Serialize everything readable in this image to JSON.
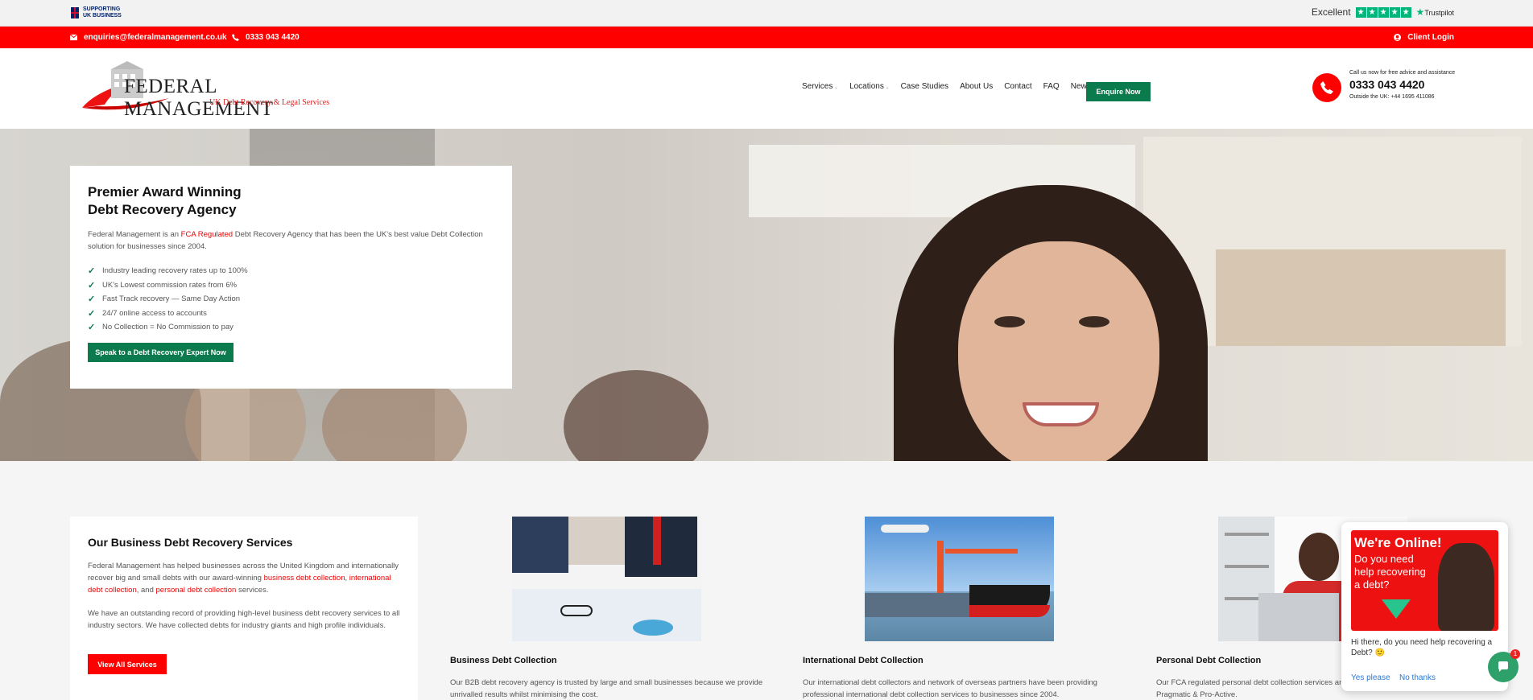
{
  "topbar": {
    "supporting_line1": "SUPPORTING",
    "supporting_line2": "UK BUSINESS",
    "trustpilot_rating": "Excellent",
    "trustpilot_brand": "Trustpilot"
  },
  "redbar": {
    "email": "enquiries@federalmanagement.co.uk",
    "phone": "0333 043 4420",
    "client_login": "Client Login"
  },
  "header": {
    "logo_main": "FEDERAL MANAGEMENT",
    "logo_sub": "UK Debt Recovery & Legal Services",
    "nav": [
      "Services",
      "Locations",
      "Case Studies",
      "About Us",
      "Contact",
      "FAQ",
      "News"
    ],
    "enquire_label": "Enquire Now",
    "call_note": "Call us now for free advice and assistance",
    "call_number": "0333 043 4420",
    "call_outside": "Outside the UK: +44 1695 411086"
  },
  "hero": {
    "title_line1": "Premier Award Winning",
    "title_line2": "Debt Recovery Agency",
    "desc_part1": "Federal Management is an ",
    "desc_link": "FCA Regulated",
    "desc_part2": " Debt Recovery Agency that has been the UK's best value Debt Collection solution for businesses since 2004.",
    "bullets": [
      "Industry leading recovery rates up to 100%",
      "UK's Lowest commission rates from 6%",
      "Fast Track recovery — Same Day Action",
      "24/7 online access to accounts",
      "No Collection = No Commission to pay"
    ],
    "cta": "Speak to a Debt Recovery Expert Now"
  },
  "services": {
    "title": "Our Business Debt Recovery Services",
    "p1_part1": "Federal Management has helped businesses across the United Kingdom and internationally recover big and small debts with our award-winning ",
    "p1_link1": "business debt collection",
    "p1_sep": ", ",
    "p1_link2": "international debt collection",
    "p1_and": ", and ",
    "p1_link3": "personal debt collection",
    "p1_end": " services.",
    "p2": "We have an outstanding record of providing high-level business debt recovery services to all industry sectors. We have collected debts for industry giants and high profile individuals.",
    "button": "View All Services",
    "columns": [
      {
        "title": "Business Debt Collection",
        "text": "Our B2B debt recovery agency is trusted by large and small businesses because we provide unrivalled results whilst minimising the cost."
      },
      {
        "title": "International Debt Collection",
        "text": "Our international debt collectors and network of overseas partners have been providing professional international debt collection services to businesses since 2004."
      },
      {
        "title": "Personal Debt Collection",
        "text": "Our FCA regulated personal debt collection services and debt collectors are Professional, Pragmatic & Pro-Active."
      }
    ]
  },
  "chat": {
    "headline": "We're Online!",
    "subline": "Do you need help recovering a debt?",
    "question": "Hi there, do you need help recovering a Debt? 🙂",
    "yes": "Yes please",
    "no": "No thanks",
    "badge": "1"
  },
  "colors": {
    "brand_red": "#ff0000",
    "brand_green": "#0b7a4c",
    "trustpilot_green": "#00b67a"
  }
}
